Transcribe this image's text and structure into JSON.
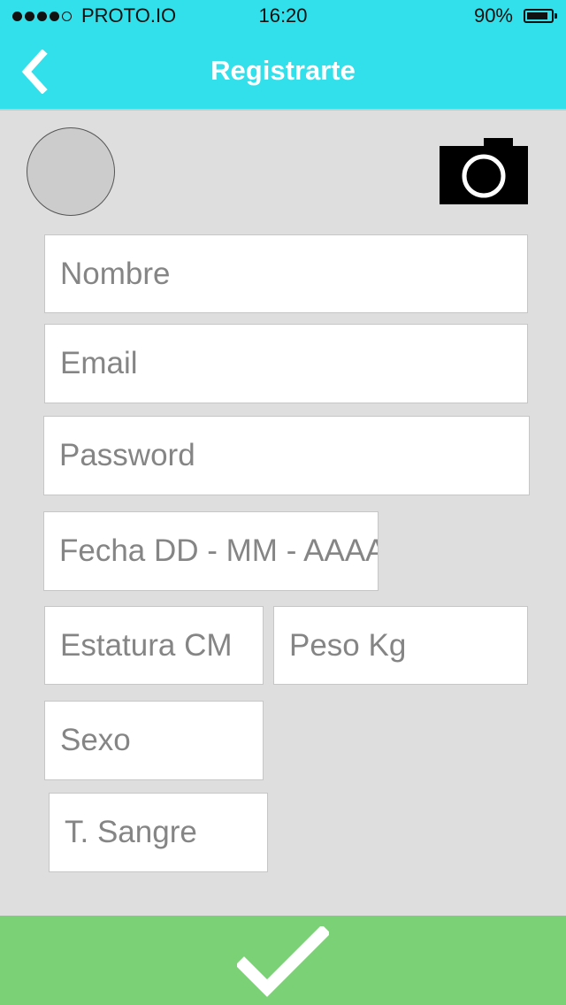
{
  "status_bar": {
    "carrier": "PROTO.IO",
    "time": "16:20",
    "battery": "90%",
    "battery_level": 0.9,
    "signal_bars_filled": 4,
    "signal_bars_total": 5
  },
  "header": {
    "title": "Registrarte",
    "back_icon": "chevron-left-icon",
    "background_color": "#31e0ea"
  },
  "profile": {
    "avatar_color": "#cccccc",
    "camera_icon": "camera-icon"
  },
  "form": {
    "nombre_placeholder": "Nombre",
    "email_placeholder": "Email",
    "password_placeholder": "Password",
    "fecha_placeholder": "Fecha DD - MM - AAAA",
    "estatura_placeholder": "Estatura CM",
    "peso_placeholder": "Peso Kg",
    "sexo_placeholder": "Sexo",
    "sangre_placeholder": "T. Sangre"
  },
  "submit": {
    "icon": "checkmark-icon",
    "background_color": "#7bd176"
  }
}
